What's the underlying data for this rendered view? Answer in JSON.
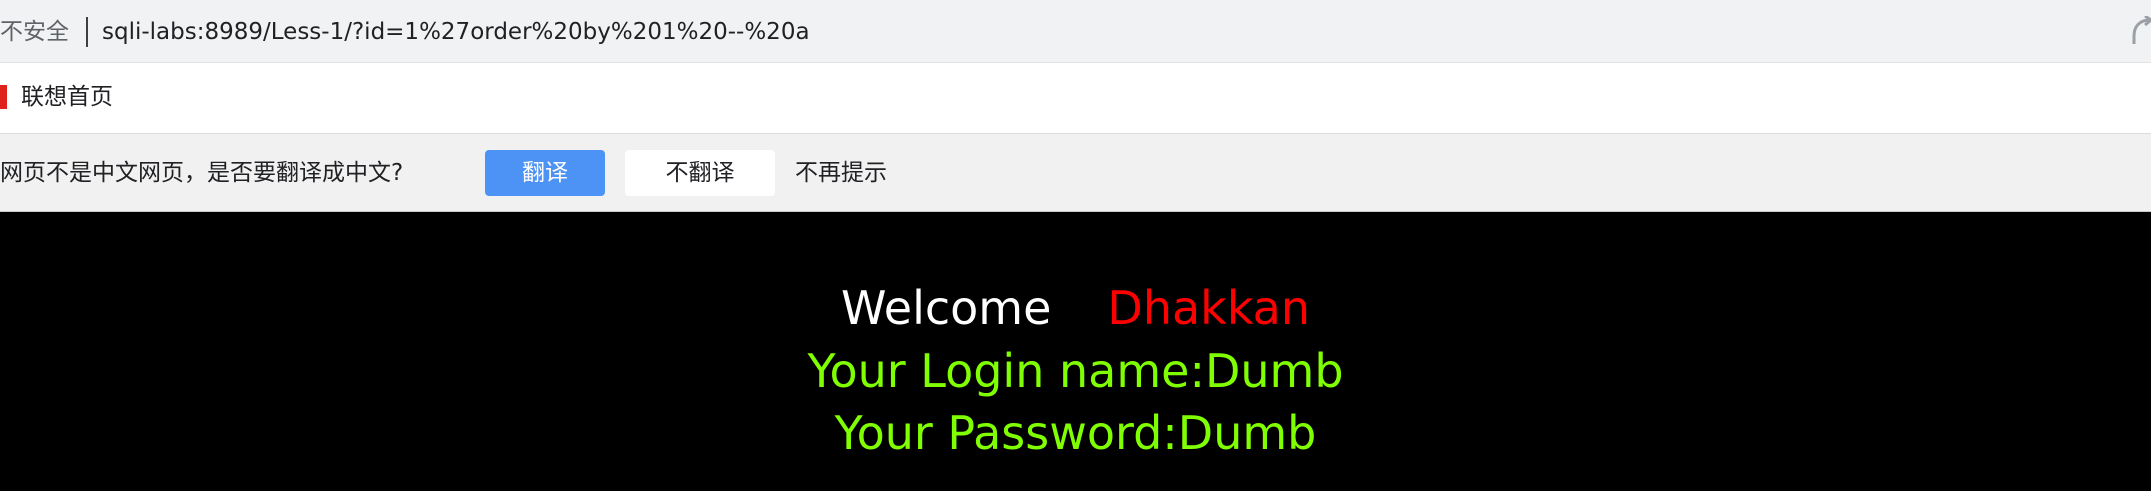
{
  "browser": {
    "security_label": "不安全",
    "url": "sqli-labs:8989/Less-1/?id=1%27order%20by%201%20--%20a",
    "share_icon": "share-icon"
  },
  "bookmarks": {
    "items": [
      {
        "label": "联想首页",
        "icon": "lenovo-favicon-icon"
      }
    ]
  },
  "translate_bar": {
    "prompt": "网页不是中文网页，是否要翻译成中文?",
    "translate_button": "翻译",
    "no_translate_button": "不翻译",
    "never_link": "不再提示",
    "accent_color": "#4c93f5"
  },
  "page": {
    "welcome_word": "Welcome",
    "welcome_name": "Dhakkan",
    "login_line": "Your Login name:Dumb",
    "password_line": "Your Password:Dumb",
    "colors": {
      "background": "#000000",
      "welcome": "#ffffff",
      "name": "#ff0000",
      "result": "#80ff00"
    }
  }
}
